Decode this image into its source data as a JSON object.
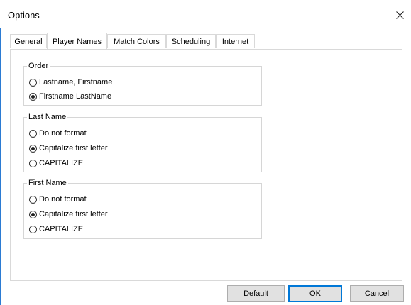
{
  "window": {
    "title": "Options"
  },
  "tabs": [
    {
      "label": "General",
      "active": false
    },
    {
      "label": "Player Names",
      "active": true
    },
    {
      "label": "Match Colors",
      "active": false
    },
    {
      "label": "Scheduling",
      "active": false
    },
    {
      "label": "Internet",
      "active": false
    }
  ],
  "groups": {
    "order": {
      "legend": "Order",
      "options": [
        {
          "label": "Lastname, Firstname",
          "checked": false
        },
        {
          "label": "Firstname LastName",
          "checked": true
        }
      ]
    },
    "last_name": {
      "legend": "Last Name",
      "options": [
        {
          "label": "Do not format",
          "checked": false
        },
        {
          "label": "Capitalize first letter",
          "checked": true
        },
        {
          "label": "CAPITALIZE",
          "checked": false
        }
      ]
    },
    "first_name": {
      "legend": "First Name",
      "options": [
        {
          "label": "Do not format",
          "checked": false
        },
        {
          "label": "Capitalize first letter",
          "checked": true
        },
        {
          "label": "CAPITALIZE",
          "checked": false
        }
      ]
    }
  },
  "buttons": {
    "default": "Default",
    "ok": "OK",
    "cancel": "Cancel"
  },
  "icons": {
    "close": "close-icon"
  },
  "colors": {
    "accent": "#0078d7",
    "window_edge": "#2b7bd3"
  }
}
